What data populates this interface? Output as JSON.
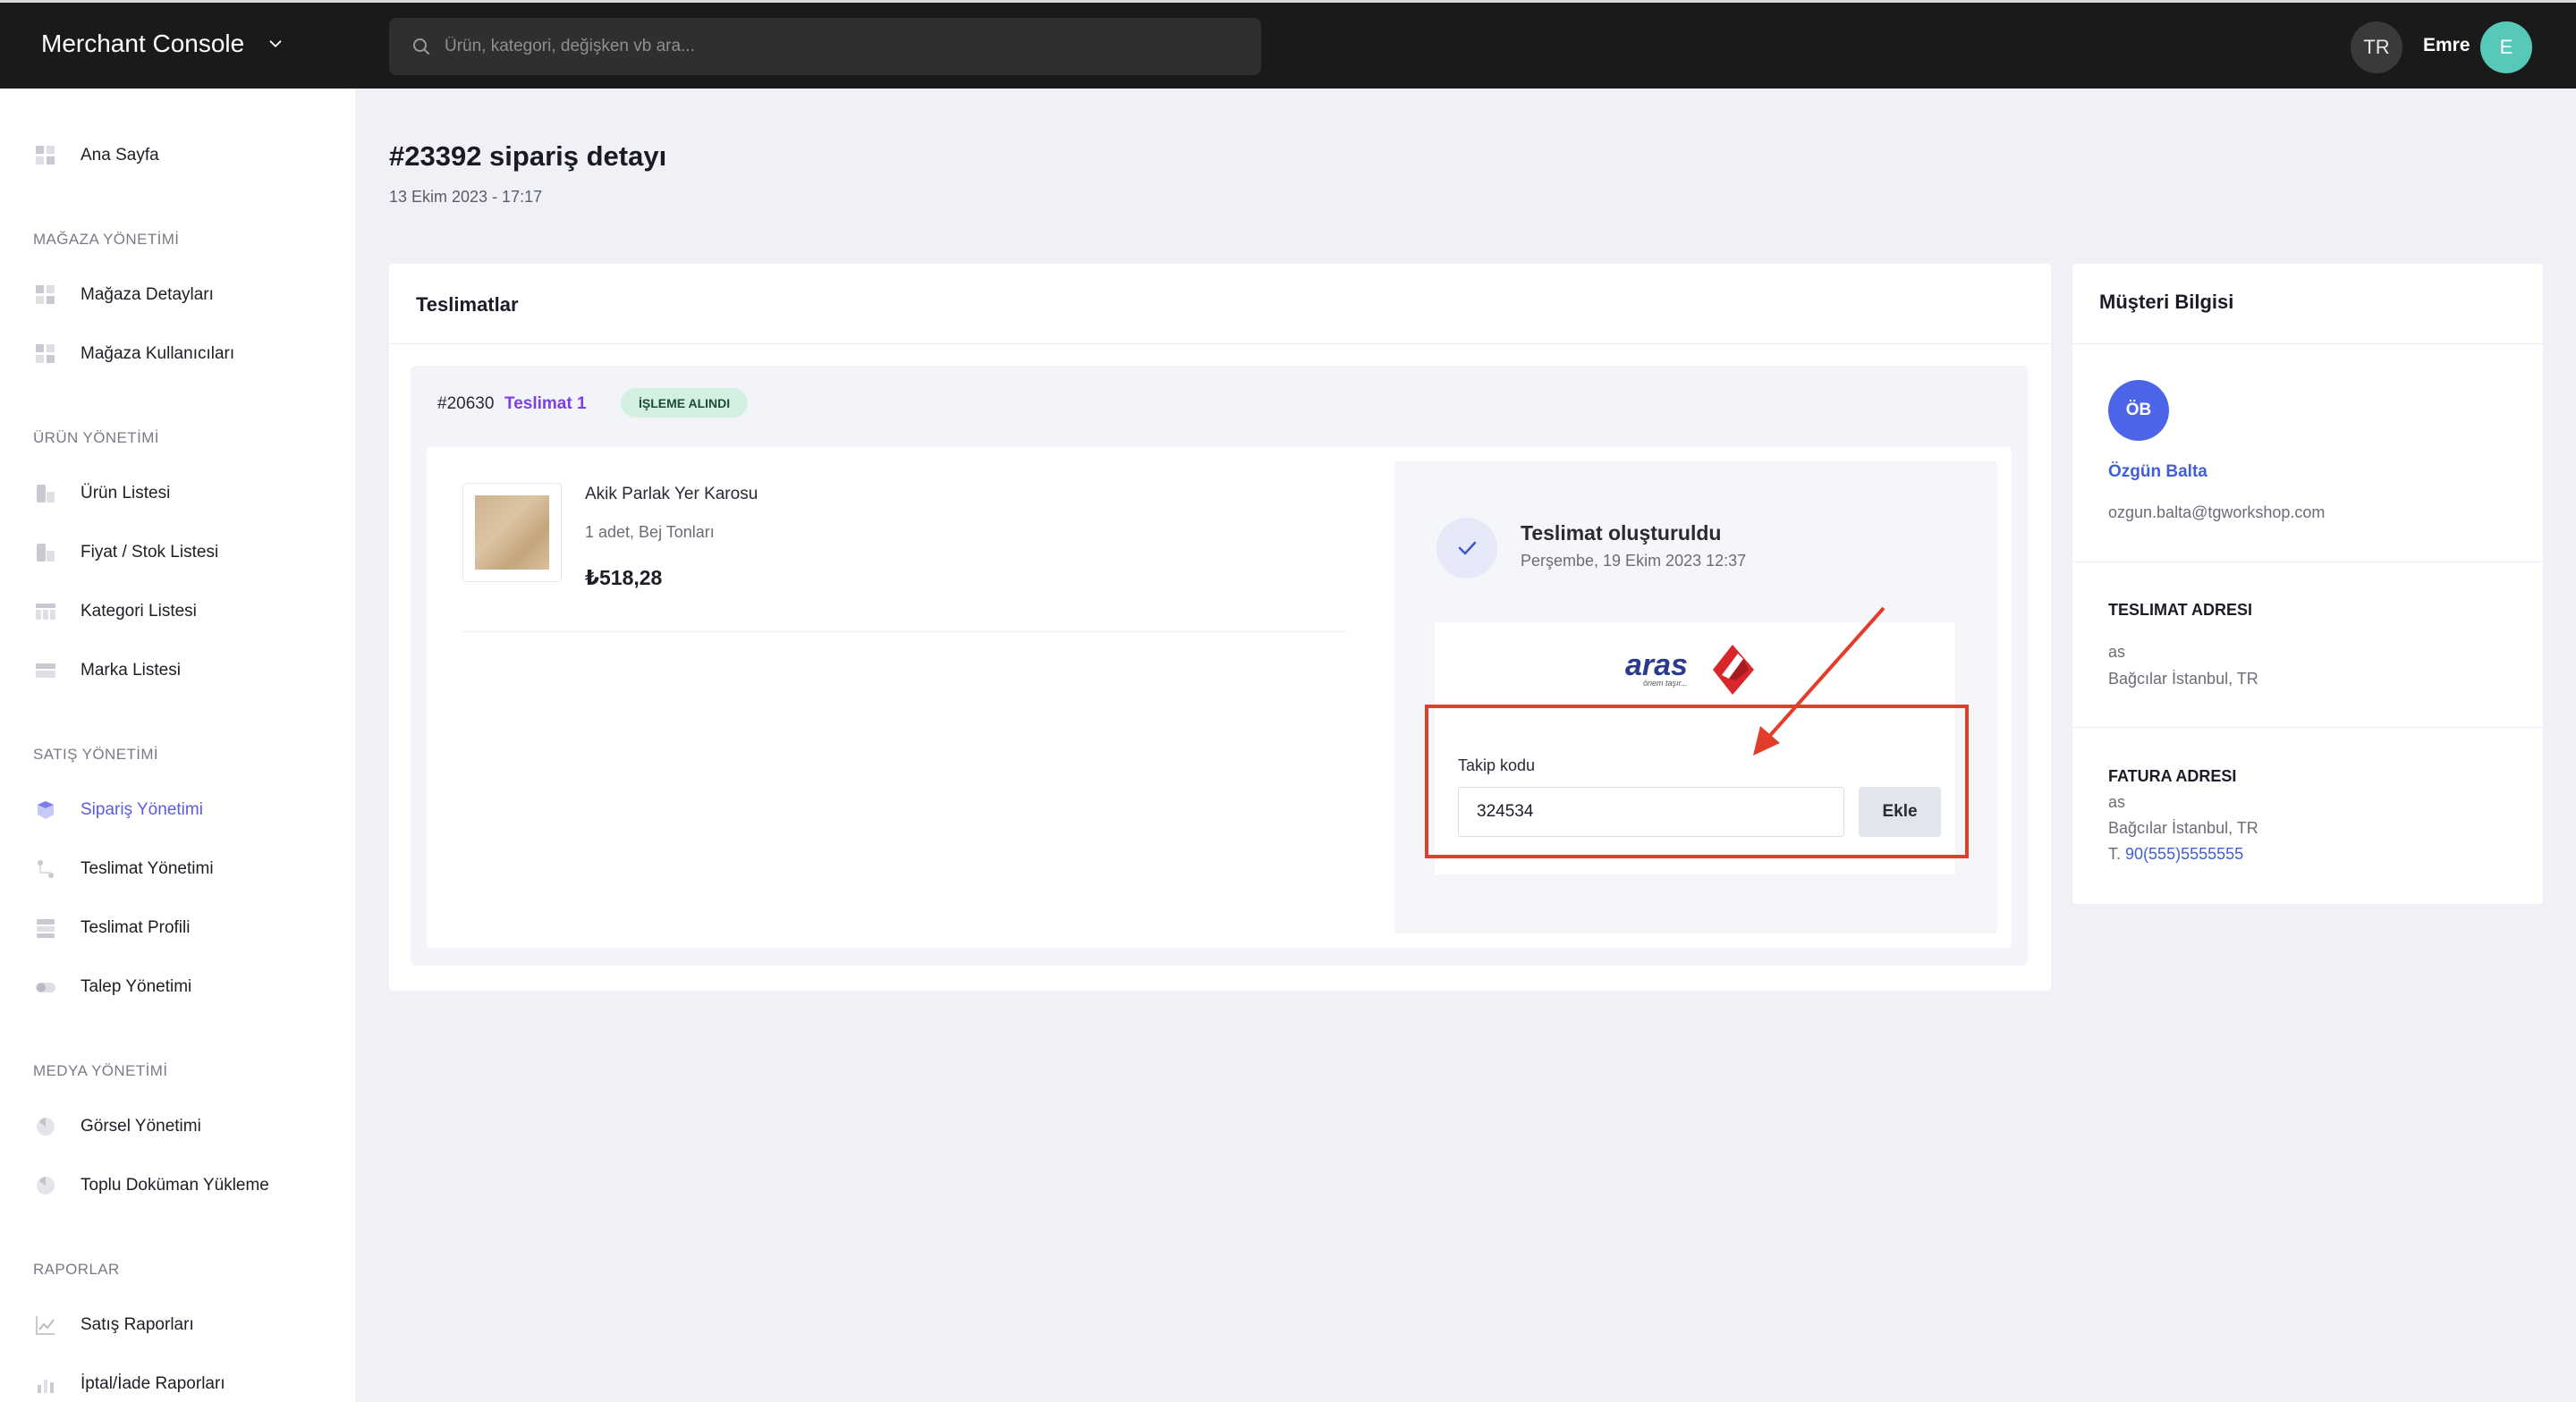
{
  "app": {
    "title": "Merchant Console",
    "language": "TR",
    "user_name": "Emre",
    "user_initial": "E"
  },
  "search": {
    "placeholder": "Ürün, kategori, değişken vb ara..."
  },
  "sidebar": {
    "home": "Ana Sayfa",
    "sections": [
      {
        "title": "MAĞAZA YÖNETİMİ",
        "items": [
          "Mağaza Detayları",
          "Mağaza Kullanıcıları"
        ]
      },
      {
        "title": "ÜRÜN YÖNETİMİ",
        "items": [
          "Ürün Listesi",
          "Fiyat / Stok Listesi",
          "Kategori Listesi",
          "Marka Listesi"
        ]
      },
      {
        "title": "SATIŞ YÖNETİMİ",
        "items": [
          "Sipariş Yönetimi",
          "Teslimat Yönetimi",
          "Teslimat Profili",
          "Talep Yönetimi"
        ]
      },
      {
        "title": "MEDYA YÖNETİMİ",
        "items": [
          "Görsel Yönetimi",
          "Toplu Doküman Yükleme"
        ]
      },
      {
        "title": "RAPORLAR",
        "items": [
          "Satış Raporları",
          "İptal/İade Raporları"
        ]
      }
    ],
    "active_item": "Sipariş Yönetimi"
  },
  "order": {
    "title": "#23392 sipariş detayı",
    "date": "13 Ekim 2023 - 17:17"
  },
  "deliveries": {
    "title": "Teslimatlar",
    "shipment_id": "#20630",
    "shipment_name": "Teslimat 1",
    "status_badge": "İŞLEME ALINDI",
    "product": {
      "name": "Akik Parlak Yer Karosu",
      "meta": "1 adet, Bej Tonları",
      "price": "₺518,28"
    },
    "tracking": {
      "status_title": "Teslimat oluşturuldu",
      "status_date": "Perşembe, 19 Ekim 2023 12:37",
      "carrier_logo_text": "aras",
      "carrier_tagline": "önem taşır...",
      "label": "Takip kodu",
      "code": "324534",
      "add_label": "Ekle"
    }
  },
  "customer": {
    "title": "Müşteri Bilgisi",
    "initials": "ÖB",
    "name": "Özgün Balta",
    "email": "ozgun.balta@tgworkshop.com",
    "shipping": {
      "title": "TESLIMAT ADRESI",
      "line1": "as",
      "line2": "Bağcılar İstanbul, TR"
    },
    "billing": {
      "title": "FATURA ADRESI",
      "line1": "as",
      "line2": "Bağcılar İstanbul, TR",
      "phone_prefix": "T.",
      "phone": "90(555)5555555"
    }
  },
  "colors": {
    "accent": "#5b5be0",
    "link": "#3e5fd8",
    "shipment_link": "#7b3fe4",
    "badge_bg": "#d4f0e0",
    "highlight": "#e23d2a",
    "topbar": "#1a1a1a",
    "avatar_user": "#56c9b8",
    "avatar_customer": "#4c64e8"
  }
}
